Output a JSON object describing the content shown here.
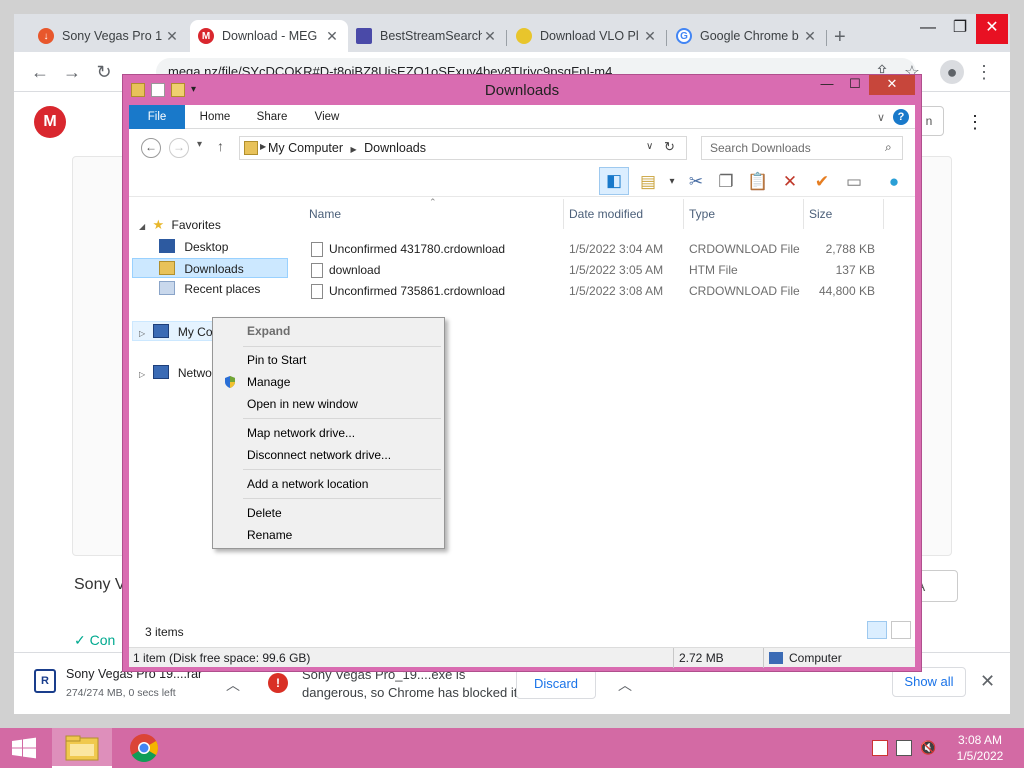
{
  "chrome": {
    "tabs": [
      {
        "title": "Sony Vegas Pro 1",
        "favicon": "download-icon",
        "color": "#e8572c",
        "active": false
      },
      {
        "title": "Download - MEG",
        "favicon": "mega-icon",
        "color": "#d9272e",
        "active": true
      },
      {
        "title": "BestStreamSearch",
        "favicon": "stream-icon",
        "color": "#4a4aa8",
        "active": false
      },
      {
        "title": "Download VLO Pl",
        "favicon": "vlo-icon",
        "color": "#e8c52c",
        "active": false
      },
      {
        "title": "Google Chrome b",
        "favicon": "google-icon",
        "color": "#4285f4",
        "active": false
      }
    ],
    "url": "mega.nz/file/SYcDCOKR#D-t8oiBZ8UisEZO1oSExuy4bey8TIriyc9psgFpI-m4",
    "page": {
      "logo": "M",
      "title_partial": "Sony V",
      "right_button_partial": "GA",
      "check_partial": "Con",
      "top_right_partial": "n"
    },
    "downloads": [
      {
        "name": "Sony Vegas Pro 19....rar",
        "status": "274/274 MB, 0 secs left"
      },
      {
        "warning_line1": "Sony Vegas Pro_19....exe is",
        "warning_line2": "dangerous, so Chrome has blocked it.",
        "action": "Discard"
      }
    ],
    "show_all": "Show all"
  },
  "explorer": {
    "title": "Downloads",
    "ribbon_tabs": [
      "File",
      "Home",
      "Share",
      "View"
    ],
    "breadcrumb": [
      "My Computer",
      "Downloads"
    ],
    "search_placeholder": "Search Downloads",
    "nav": {
      "favorites": "Favorites",
      "desktop": "Desktop",
      "downloads": "Downloads",
      "recent": "Recent places",
      "computer": "My Computer",
      "network": "Network"
    },
    "columns": {
      "name": "Name",
      "date": "Date modified",
      "type": "Type",
      "size": "Size"
    },
    "files": [
      {
        "name": "Unconfirmed 431780.crdownload",
        "date": "1/5/2022 3:04 AM",
        "type": "CRDOWNLOAD File",
        "size": "2,788 KB"
      },
      {
        "name": "download",
        "date": "1/5/2022 3:05 AM",
        "type": "HTM File",
        "size": "137 KB"
      },
      {
        "name": "Unconfirmed 735861.crdownload",
        "date": "1/5/2022 3:08 AM",
        "type": "CRDOWNLOAD File",
        "size": "44,800 KB"
      }
    ],
    "item_count": "3 items",
    "status": {
      "selection": "1 item (Disk free space: 99.6 GB)",
      "size": "2.72 MB",
      "location": "Computer"
    }
  },
  "context_menu": {
    "items": [
      {
        "label": "Expand",
        "disabled": true
      },
      {
        "sep": true
      },
      {
        "label": "Pin to Start"
      },
      {
        "label": "Manage",
        "icon": "uac-shield-icon"
      },
      {
        "label": "Open in new window"
      },
      {
        "sep": true
      },
      {
        "label": "Map network drive..."
      },
      {
        "label": "Disconnect network drive..."
      },
      {
        "sep": true
      },
      {
        "label": "Add a network location"
      },
      {
        "sep": true
      },
      {
        "label": "Delete"
      },
      {
        "label": "Rename"
      }
    ]
  },
  "taskbar": {
    "time": "3:08 AM",
    "date": "1/5/2022",
    "accent": "#d36aa4"
  }
}
